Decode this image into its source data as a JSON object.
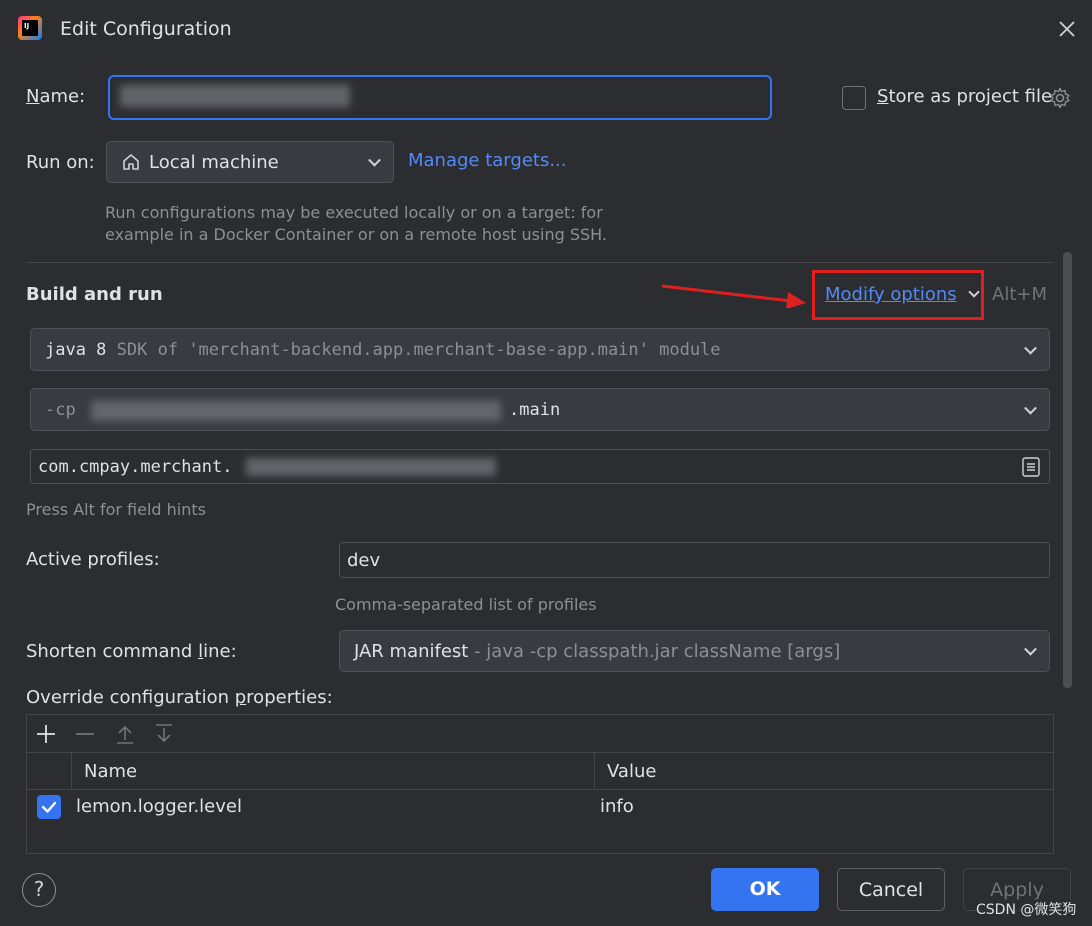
{
  "window": {
    "title": "Edit Configuration"
  },
  "name_field": {
    "label_prefix": "",
    "label_mnemonic": "N",
    "label_rest": "ame:"
  },
  "store_project": {
    "mnemonic": "S",
    "rest": "tore as project file"
  },
  "run_on": {
    "label": "Run on:",
    "value": "Local machine",
    "manage_targets": "Manage targets..."
  },
  "run_on_hint": [
    "Run configurations may be executed locally or on a target: for",
    "example in a Docker Container or on a remote host using SSH."
  ],
  "build_run": {
    "title": "Build and run",
    "modify_mnemonic": "M",
    "modify_rest": "odify options",
    "shortcut": "Alt+M",
    "sdk_main": "java 8",
    "sdk_sub": "SDK of 'merchant-backend.app.merchant-base-app.main' module",
    "cp_prefix": "-cp",
    "cp_suffix": ".main",
    "main_class": "com.cmpay.merchant.",
    "field_hints": "Press Alt for field hints"
  },
  "active_profiles": {
    "label": "Active profiles:",
    "value": "dev",
    "hint": "Comma-separated list of profiles"
  },
  "shorten": {
    "label_pre": "Shorten command ",
    "label_mnemonic": "l",
    "label_post": "ine:",
    "value_main": "JAR manifest",
    "value_sub": " - java -cp classpath.jar className [args]"
  },
  "override": {
    "label_pre": "Override configuration ",
    "label_mnemonic": "p",
    "label_post": "roperties:",
    "columns": [
      "Name",
      "Value"
    ],
    "rows": [
      {
        "checked": true,
        "name": "lemon.logger.level",
        "value": "info"
      }
    ]
  },
  "buttons": {
    "help": "?",
    "ok": "OK",
    "cancel": "Cancel",
    "apply": "Apply"
  },
  "watermark": "CSDN @微笑狗",
  "colors": {
    "accent": "#3574f0",
    "link": "#548af7",
    "highlight_red": "#e02020"
  }
}
